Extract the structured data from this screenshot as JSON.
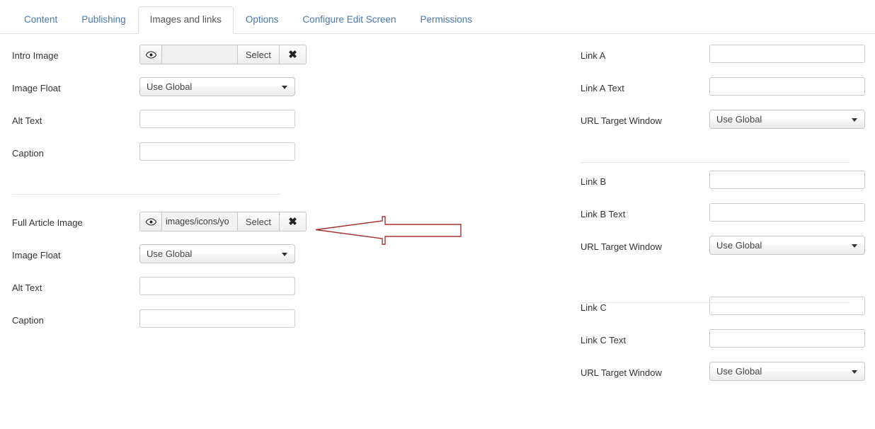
{
  "tabs": [
    {
      "label": "Content",
      "active": false
    },
    {
      "label": "Publishing",
      "active": false
    },
    {
      "label": "Images and links",
      "active": true
    },
    {
      "label": "Options",
      "active": false
    },
    {
      "label": "Configure Edit Screen",
      "active": false
    },
    {
      "label": "Permissions",
      "active": false
    }
  ],
  "colors": {
    "tab_link": "#4a77a8",
    "tab_active_text": "#555555",
    "label_text": "#333333",
    "border": "#cccccc",
    "divider": "#e7e7e7",
    "annotation": "#a63232"
  },
  "left_column": {
    "intro_image": {
      "label": "Intro Image",
      "eye_icon": "eye-icon",
      "path_value": "",
      "path_placeholder": "",
      "select_label": "Select",
      "clear_icon": "close-x-icon"
    },
    "intro_image_float": {
      "label": "Image Float",
      "value": "Use Global",
      "caret_icon": "chevron-down-icon"
    },
    "intro_alt_text": {
      "label": "Alt Text",
      "value": "",
      "placeholder": ""
    },
    "intro_caption": {
      "label": "Caption",
      "value": "",
      "placeholder": ""
    },
    "full_article_image": {
      "label": "Full Article Image",
      "eye_icon": "eye-icon",
      "path_value": "images/icons/yo",
      "path_placeholder": "",
      "select_label": "Select",
      "clear_icon": "close-x-icon"
    },
    "full_image_float": {
      "label": "Image Float",
      "value": "Use Global",
      "caret_icon": "chevron-down-icon"
    },
    "full_alt_text": {
      "label": "Alt Text",
      "value": "",
      "placeholder": ""
    },
    "full_caption": {
      "label": "Caption",
      "value": "",
      "placeholder": ""
    }
  },
  "right_column": {
    "link_a": {
      "label": "Link A",
      "value": "",
      "placeholder": ""
    },
    "link_a_text": {
      "label": "Link A Text",
      "value": "",
      "placeholder": ""
    },
    "target_a": {
      "label": "URL Target Window",
      "value": "Use Global",
      "caret_icon": "chevron-down-icon"
    },
    "link_b": {
      "label": "Link B",
      "value": "",
      "placeholder": ""
    },
    "link_b_text": {
      "label": "Link B Text",
      "value": "",
      "placeholder": ""
    },
    "target_b": {
      "label": "URL Target Window",
      "value": "Use Global",
      "caret_icon": "chevron-down-icon"
    },
    "link_c": {
      "label": "Link C",
      "value": "",
      "placeholder": ""
    },
    "link_c_text": {
      "label": "Link C Text",
      "value": "",
      "placeholder": ""
    },
    "target_c": {
      "label": "URL Target Window",
      "value": "Use Global",
      "caret_icon": "chevron-down-icon"
    }
  },
  "annotation": {
    "shape": "left-pointing-arrow",
    "color": "#a63232"
  }
}
